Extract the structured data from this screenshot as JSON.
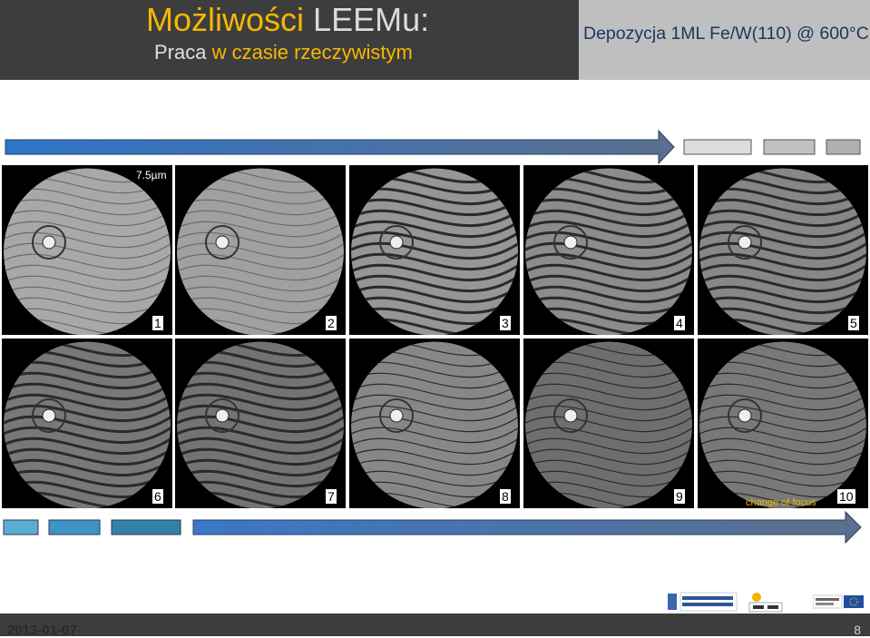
{
  "header": {
    "title_part1": "Możliwości",
    "title_part2": "LEEMu:",
    "subtitle_part1": "Praca",
    "subtitle_part2": "w czasie",
    "subtitle_part3": "rzeczywistym",
    "experiment_title": "Depozycja 1ML Fe/W(110) @ 600°C"
  },
  "images": [
    {
      "label": "1"
    },
    {
      "label": "2"
    },
    {
      "label": "3"
    },
    {
      "label": "4"
    },
    {
      "label": "5"
    },
    {
      "label": "6"
    },
    {
      "label": "7"
    },
    {
      "label": "8"
    },
    {
      "label": "9"
    },
    {
      "label": "10"
    }
  ],
  "annotations": {
    "scale_bar": "7.5µm",
    "focus_note": "change of focus"
  },
  "footer": {
    "date": "2013-01-07",
    "page_number": "8"
  },
  "colors": {
    "header_bg": "#3d3d3d",
    "accent_gold": "#f5b800",
    "exp_title_color": "#17375e",
    "arrow_blue": "#4e73b6"
  }
}
